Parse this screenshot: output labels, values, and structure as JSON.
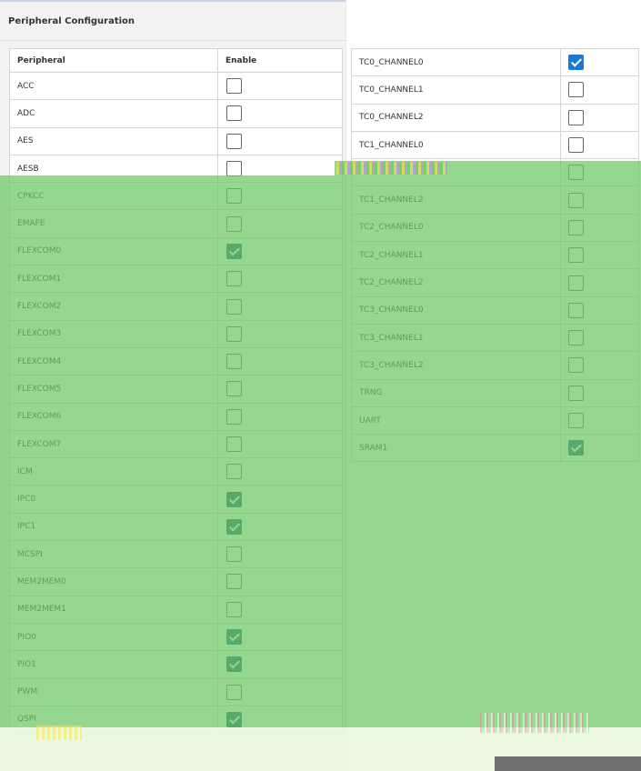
{
  "panel": {
    "title": "Peripheral Configuration"
  },
  "left_table": {
    "headers": {
      "peripheral": "Peripheral",
      "enable": "Enable"
    },
    "rows": [
      {
        "name": "ACC",
        "enabled": false
      },
      {
        "name": "ADC",
        "enabled": false
      },
      {
        "name": "AES",
        "enabled": false
      },
      {
        "name": "AESB",
        "enabled": false
      },
      {
        "name": "CPKCC",
        "enabled": false
      },
      {
        "name": "EMAFE",
        "enabled": false
      },
      {
        "name": "FLEXCOM0",
        "enabled": true
      },
      {
        "name": "FLEXCOM1",
        "enabled": false
      },
      {
        "name": "FLEXCOM2",
        "enabled": false
      },
      {
        "name": "FLEXCOM3",
        "enabled": false
      },
      {
        "name": "FLEXCOM4",
        "enabled": false
      },
      {
        "name": "FLEXCOM5",
        "enabled": false
      },
      {
        "name": "FLEXCOM6",
        "enabled": false
      },
      {
        "name": "FLEXCOM7",
        "enabled": false
      },
      {
        "name": "ICM",
        "enabled": false
      },
      {
        "name": "IPC0",
        "enabled": true
      },
      {
        "name": "IPC1",
        "enabled": true
      },
      {
        "name": "MCSPI",
        "enabled": false
      },
      {
        "name": "MEM2MEM0",
        "enabled": false
      },
      {
        "name": "MEM2MEM1",
        "enabled": false
      },
      {
        "name": "PIO0",
        "enabled": true
      },
      {
        "name": "PIO1",
        "enabled": true
      },
      {
        "name": "PWM",
        "enabled": false
      },
      {
        "name": "QSPI",
        "enabled": true
      }
    ]
  },
  "right_table": {
    "rows": [
      {
        "name": "TC0_CHANNEL0",
        "enabled": true,
        "style": "bright"
      },
      {
        "name": "TC0_CHANNEL1",
        "enabled": false
      },
      {
        "name": "TC0_CHANNEL2",
        "enabled": false
      },
      {
        "name": "TC1_CHANNEL0",
        "enabled": false
      },
      {
        "name": "",
        "enabled": false
      },
      {
        "name": "TC1_CHANNEL2",
        "enabled": false
      },
      {
        "name": "TC2_CHANNEL0",
        "enabled": false
      },
      {
        "name": "TC2_CHANNEL1",
        "enabled": false
      },
      {
        "name": "TC2_CHANNEL2",
        "enabled": false
      },
      {
        "name": "TC3_CHANNEL0",
        "enabled": false
      },
      {
        "name": "TC3_CHANNEL1",
        "enabled": false
      },
      {
        "name": "TC3_CHANNEL2",
        "enabled": false
      },
      {
        "name": "TRNG",
        "enabled": false
      },
      {
        "name": "UART",
        "enabled": false
      },
      {
        "name": "SRAM1",
        "enabled": true
      }
    ]
  },
  "colors": {
    "checked": "#1a5e8a",
    "checked_bright": "#1979d3",
    "overlay": "#6ec864"
  }
}
